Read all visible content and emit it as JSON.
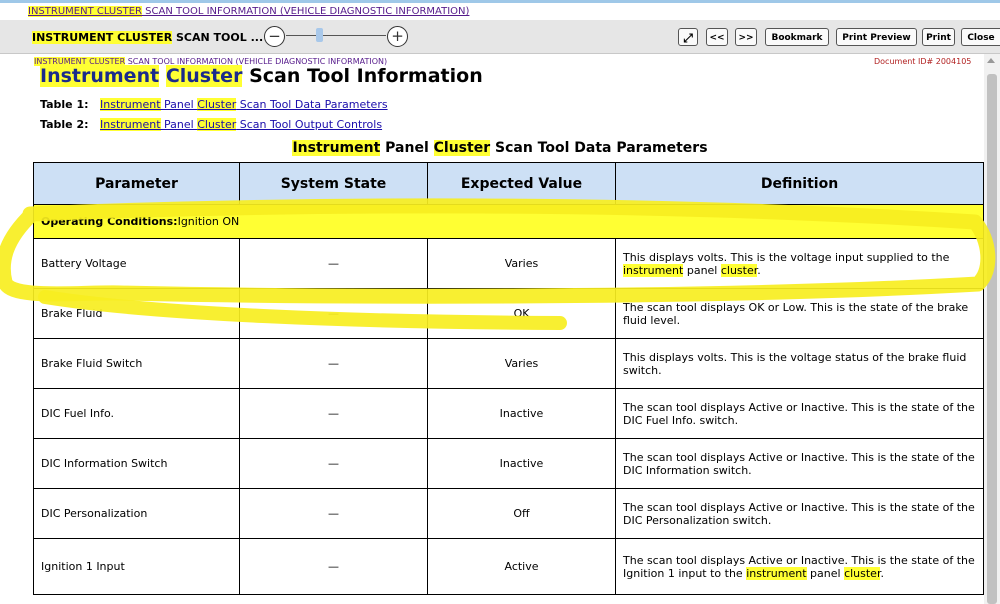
{
  "top_link": {
    "hl": "INSTRUMENT CLUSTER",
    "rest": " SCAN TOOL INFORMATION (VEHICLE DIAGNOSTIC INFORMATION)"
  },
  "toolbar": {
    "title_hl": "INSTRUMENT CLUSTER",
    "title_rest": " SCAN TOOL ...",
    "zoom_out": "−",
    "zoom_in": "+",
    "expand_icon": "⤢",
    "prev": "<<",
    "next": ">>",
    "bookmark": "Bookmark",
    "print_preview": "Print Preview",
    "print": "Print",
    "close": "Close"
  },
  "breadcrumb": {
    "hl": "INSTRUMENT CLUSTER",
    "rest": " SCAN TOOL INFORMATION (VEHICLE DIAGNOSTIC INFORMATION)"
  },
  "doc_id": "Document ID# 2004105",
  "title": {
    "word1": "Instrument",
    "word2": "Cluster",
    "rest": " Scan Tool Information"
  },
  "toc": [
    {
      "label": "Table 1:",
      "w1": "Instrument",
      "mid": " Panel ",
      "w2": "Cluster",
      "rest": " Scan Tool Data Parameters"
    },
    {
      "label": "Table 2:",
      "w1": "Instrument",
      "mid": " Panel ",
      "w2": "Cluster",
      "rest": " Scan Tool Output Controls"
    }
  ],
  "table_caption": {
    "w1": "Instrument",
    "mid": " Panel ",
    "w2": "Cluster",
    "rest": " Scan Tool Data Parameters"
  },
  "table": {
    "headers": [
      "Parameter",
      "System State",
      "Expected Value",
      "Definition"
    ],
    "condition": {
      "label": "Operating Conditions:",
      "value": "Ignition ON"
    },
    "rows": [
      {
        "param": "Battery Voltage",
        "state": "—",
        "value": "Varies",
        "def": [
          {
            "t": "This displays volts. This is the voltage input supplied to the "
          },
          {
            "t": "instrument",
            "hl": true
          },
          {
            "t": " panel "
          },
          {
            "t": "cluster",
            "hl": true
          },
          {
            "t": "."
          }
        ]
      },
      {
        "param": "Brake Fluid",
        "state": "—",
        "value": "OK",
        "def": [
          {
            "t": "The scan tool displays OK or Low. This is the state of the brake fluid level."
          }
        ]
      },
      {
        "param": "Brake Fluid Switch",
        "state": "—",
        "value": "Varies",
        "def": [
          {
            "t": "This displays volts. This is the voltage status of the brake fluid switch."
          }
        ]
      },
      {
        "param": "DIC Fuel Info.",
        "state": "—",
        "value": "Inactive",
        "def": [
          {
            "t": "The scan tool displays Active or Inactive. This is the state of the DIC Fuel Info. switch."
          }
        ]
      },
      {
        "param": "DIC Information Switch",
        "state": "—",
        "value": "Inactive",
        "def": [
          {
            "t": "The scan tool displays Active or Inactive. This is the state of the DIC Information switch."
          }
        ]
      },
      {
        "param": "DIC Personalization",
        "state": "—",
        "value": "Off",
        "def": [
          {
            "t": "The scan tool displays Active or Inactive. This is the state of the DIC Personalization switch."
          }
        ]
      },
      {
        "param": "Ignition 1 Input",
        "state": "—",
        "value": "Active",
        "def": [
          {
            "t": "The scan tool displays Active or Inactive. This is the state of the Ignition 1 input to the "
          },
          {
            "t": "instrument",
            "hl": true
          },
          {
            "t": " panel "
          },
          {
            "t": "cluster",
            "hl": true
          },
          {
            "t": "."
          }
        ]
      }
    ]
  },
  "colors": {
    "highlight": "#ffff33",
    "header_bg": "#cde0f5",
    "link": "#1a0dab",
    "title": "#1a2a8c",
    "doc_id": "#b22222",
    "annotation": "#f7ee1f"
  }
}
